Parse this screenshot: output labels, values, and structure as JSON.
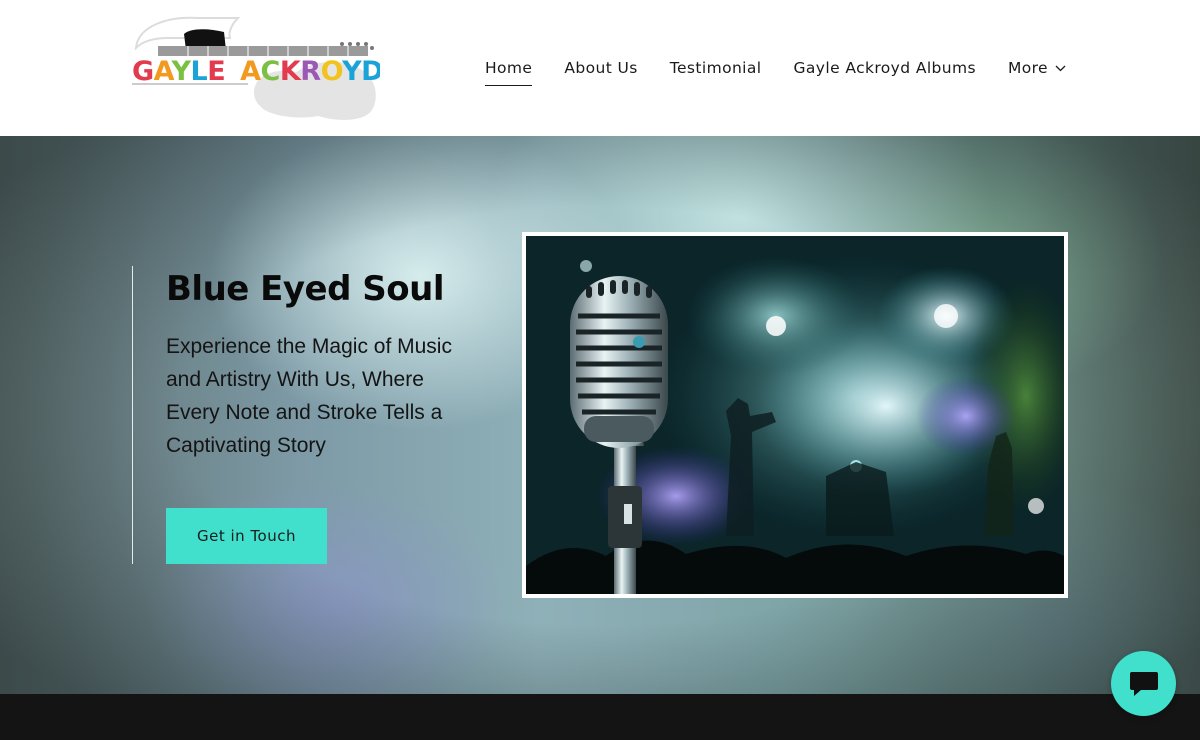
{
  "header": {
    "logo": {
      "text": "GAYLE ACKROYD",
      "icon": "guitar-icon"
    },
    "nav": [
      {
        "label": "Home",
        "active": true
      },
      {
        "label": "About Us",
        "active": false
      },
      {
        "label": "Testimonial",
        "active": false
      },
      {
        "label": "Gayle Ackroyd Albums",
        "active": false
      },
      {
        "label": "More",
        "active": false,
        "icon": "chevron-down-icon"
      }
    ]
  },
  "hero": {
    "title": "Blue Eyed Soul",
    "subtitle": "Experience the Magic of Music and Artistry With Us, Where Every Note and Stroke Tells a Captivating Story",
    "cta_label": "Get in Touch",
    "image": "vintage-microphone-concert-stage"
  },
  "chat": {
    "icon": "chat-bubble-icon"
  },
  "colors": {
    "accent": "#40e0cc",
    "text": "#1b1b1b",
    "dark_strip": "#141414"
  }
}
